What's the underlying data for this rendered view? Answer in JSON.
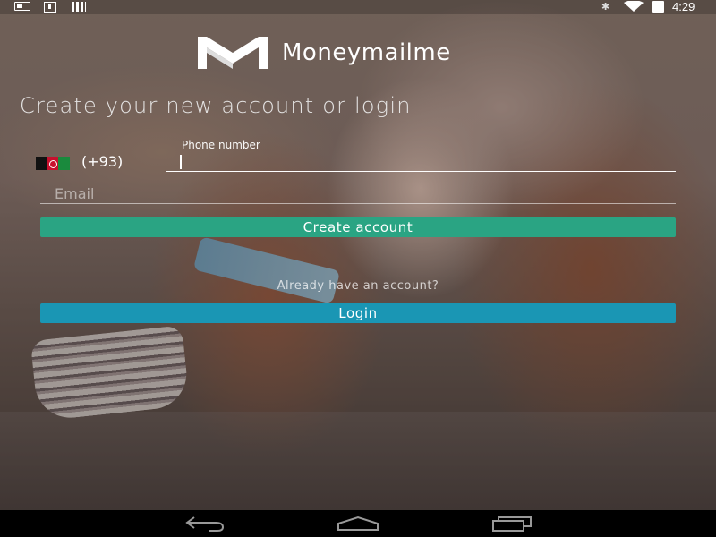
{
  "status_bar": {
    "time": "4:29",
    "left_icons": [
      "notification-card-icon",
      "download-icon",
      "signal-bars-icon"
    ],
    "right_icons": [
      "bluetooth-icon",
      "wifi-icon",
      "battery-icon"
    ],
    "bluetooth_glyph": "✱"
  },
  "app": {
    "name": "Moneymailme",
    "logo_icon": "moneymailme-logo-icon"
  },
  "form": {
    "heading": "Create your new account or login",
    "country_flag": "afghanistan-flag-icon",
    "country_code": "(+93)",
    "phone_label": "Phone number",
    "phone_value": "",
    "email_placeholder": "Email",
    "email_value": "",
    "create_label": "Create account",
    "already_text": "Already have an account?",
    "login_label": "Login"
  },
  "colors": {
    "create_button": "#2aa483",
    "login_button": "#1a96b4",
    "text": "#ffffff"
  },
  "nav_bar": {
    "icons": [
      "back-icon",
      "home-icon",
      "recents-icon"
    ]
  }
}
